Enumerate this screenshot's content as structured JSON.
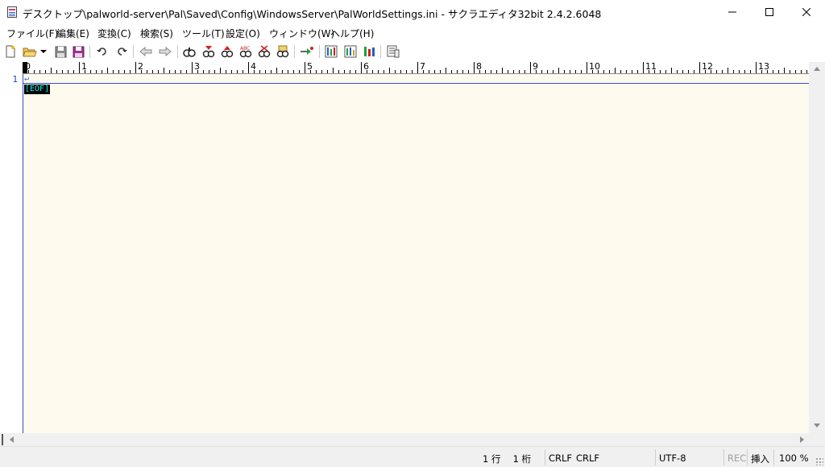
{
  "window": {
    "title": "デスクトップ\\palworld-server\\Pal\\Saved\\Config\\WindowsServer\\PalWorldSettings.ini - サクラエディタ32bit 2.4.2.6048"
  },
  "menu": [
    {
      "label": "ファイル(F)"
    },
    {
      "label": "編集(E)"
    },
    {
      "label": "変換(C)"
    },
    {
      "label": "検索(S)"
    },
    {
      "label": "ツール(T)"
    },
    {
      "label": "設定(O)"
    },
    {
      "label": "ウィンドウ(W)"
    },
    {
      "label": "ヘルプ(H)"
    }
  ],
  "toolbar_icons": [
    "new-file-icon",
    "open-folder-icon",
    "dropdown-arrow-icon",
    "save-icon",
    "save-all-icon",
    "undo-icon",
    "redo-icon",
    "jump-back-icon",
    "jump-forward-icon",
    "search-icon",
    "search-next-icon",
    "search-prev-icon",
    "replace-icon",
    "clear-highlight-icon",
    "grep-icon",
    "tag-jump-icon",
    "outline-icon",
    "compare-icon",
    "macro-icon",
    "settings-icon"
  ],
  "ruler": {
    "numbers": [
      "0",
      "1",
      "2",
      "3",
      "4",
      "5",
      "6",
      "7",
      "8",
      "9",
      "10",
      "11",
      "12",
      "13"
    ]
  },
  "editor": {
    "line_numbers": [
      "1"
    ],
    "crlf_mark": "↵",
    "eof_mark": "[EOF]",
    "background": "#fffaee"
  },
  "status": {
    "position": "1 行　 1 桁",
    "line_ending": "CRLF",
    "line_ending2": "CRLF",
    "encoding": "UTF-8",
    "rec": "REC",
    "insert_mode": "挿入",
    "zoom": "100 %"
  }
}
